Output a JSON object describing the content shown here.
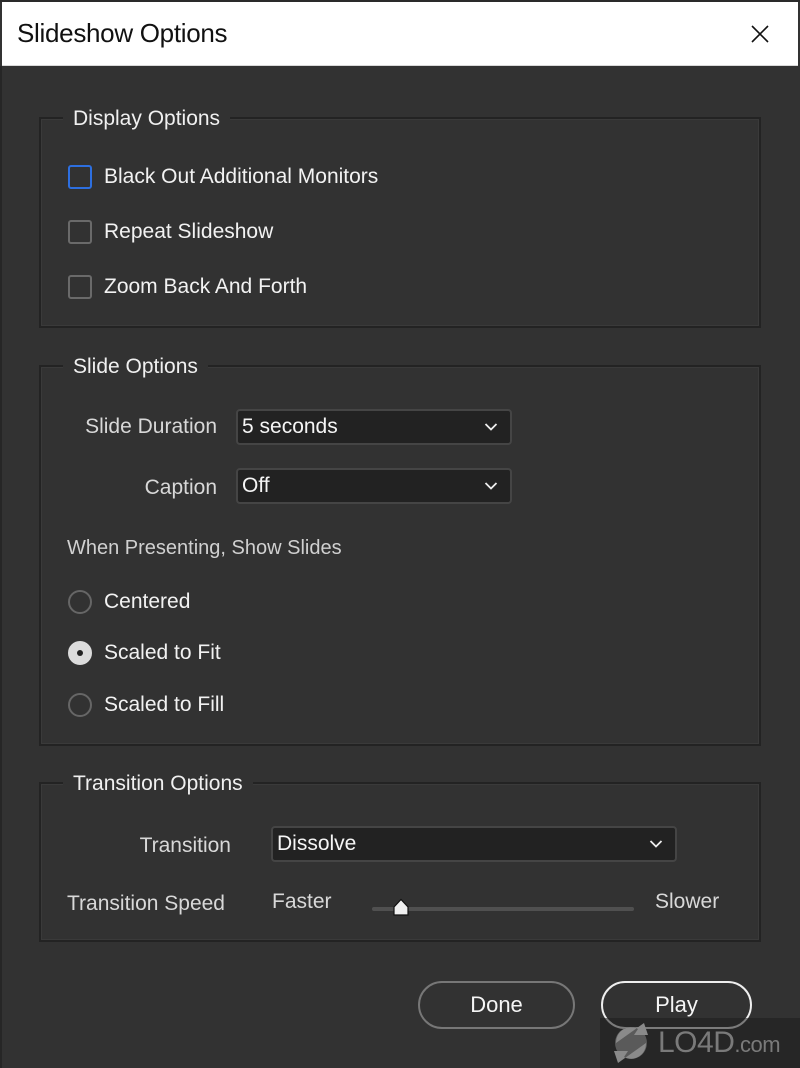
{
  "window": {
    "title": "Slideshow Options",
    "close_icon": "close-icon"
  },
  "display_options": {
    "title": "Display Options",
    "items": [
      {
        "label": "Black Out Additional Monitors",
        "checked": false,
        "focused": true
      },
      {
        "label": "Repeat Slideshow",
        "checked": false,
        "focused": false
      },
      {
        "label": "Zoom Back And Forth",
        "checked": false,
        "focused": false
      }
    ]
  },
  "slide_options": {
    "title": "Slide Options",
    "slide_duration": {
      "label": "Slide Duration",
      "value": "5 seconds"
    },
    "caption": {
      "label": "Caption",
      "value": "Off"
    },
    "show_slides_label": "When Presenting, Show Slides",
    "show_slides": [
      {
        "label": "Centered",
        "selected": false
      },
      {
        "label": "Scaled to Fit",
        "selected": true
      },
      {
        "label": "Scaled to Fill",
        "selected": false
      }
    ]
  },
  "transition_options": {
    "title": "Transition Options",
    "transition": {
      "label": "Transition",
      "value": "Dissolve"
    },
    "speed": {
      "label": "Transition Speed",
      "min_label": "Faster",
      "max_label": "Slower",
      "value_fraction": 0.11
    }
  },
  "buttons": {
    "done": "Done",
    "play": "Play"
  },
  "watermark": {
    "text": "LO4D",
    "suffix": ".com"
  },
  "colors": {
    "background": "#323232",
    "focus_accent": "#2d6fe0",
    "titlebar": "#ffffff"
  }
}
